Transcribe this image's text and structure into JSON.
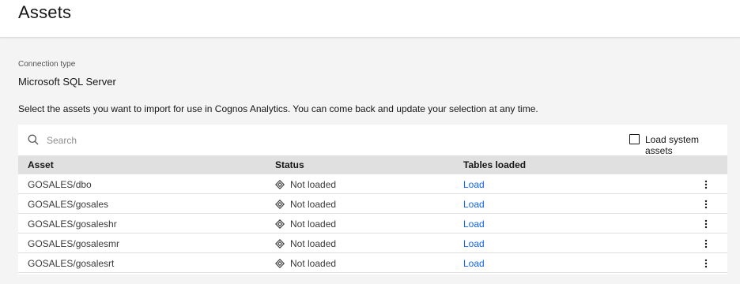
{
  "header": {
    "title": "Assets"
  },
  "connection": {
    "label": "Connection type",
    "value": "Microsoft SQL Server"
  },
  "instructions": "Select the assets you want to import for use in Cognos Analytics. You can come back and update your selection at any time.",
  "search": {
    "placeholder": "Search",
    "value": "",
    "icon": "search-icon"
  },
  "system_assets": {
    "label": "Load system assets",
    "checked": false
  },
  "table": {
    "columns": {
      "asset": "Asset",
      "status": "Status",
      "tables_loaded": "Tables loaded"
    },
    "rows": [
      {
        "asset": "GOSALES/dbo",
        "status": "Not loaded",
        "load": "Load"
      },
      {
        "asset": "GOSALES/gosales",
        "status": "Not loaded",
        "load": "Load"
      },
      {
        "asset": "GOSALES/gosaleshr",
        "status": "Not loaded",
        "load": "Load"
      },
      {
        "asset": "GOSALES/gosalesmr",
        "status": "Not loaded",
        "load": "Load"
      },
      {
        "asset": "GOSALES/gosalesrt",
        "status": "Not loaded",
        "load": "Load"
      }
    ]
  },
  "colors": {
    "link": "#0f62fe",
    "header_bg": "#e0e0e0",
    "page_bg": "#f4f4f4"
  }
}
